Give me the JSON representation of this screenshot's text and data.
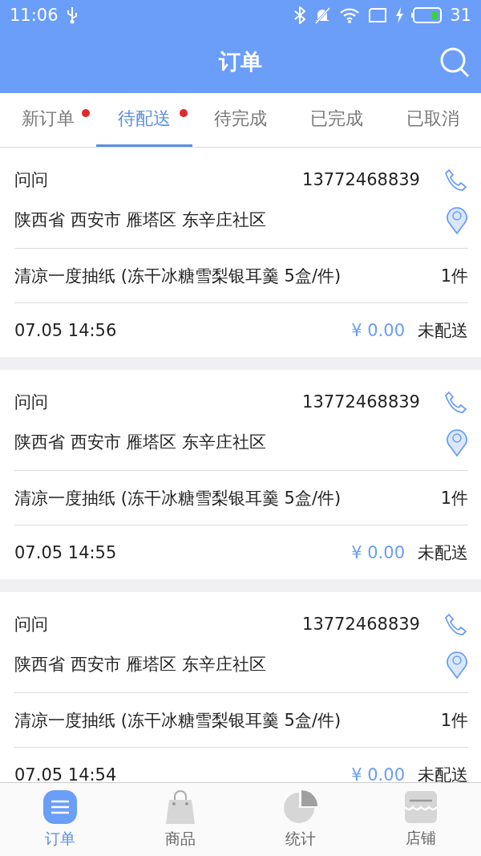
{
  "status_bar": {
    "time": "11:06",
    "battery_text": "31"
  },
  "header": {
    "title": "订单"
  },
  "tabs": [
    {
      "label": "新订单",
      "selected": false,
      "badge": true
    },
    {
      "label": "待配送",
      "selected": true,
      "badge": true
    },
    {
      "label": "待完成",
      "selected": false,
      "badge": false
    },
    {
      "label": "已完成",
      "selected": false,
      "badge": false
    },
    {
      "label": "已取消",
      "selected": false,
      "badge": false
    }
  ],
  "orders": [
    {
      "name": "问问",
      "phone": "13772468839",
      "address": "陕西省 西安市 雁塔区 东辛庄社区",
      "product": "清凉一度抽纸 (冻干冰糖雪梨银耳羹 5盒/件)",
      "quantity": "1件",
      "time": "07.05 14:56",
      "price": "¥ 0.00",
      "status": "未配送"
    },
    {
      "name": "问问",
      "phone": "13772468839",
      "address": "陕西省 西安市 雁塔区 东辛庄社区",
      "product": "清凉一度抽纸 (冻干冰糖雪梨银耳羹 5盒/件)",
      "quantity": "1件",
      "time": "07.05 14:55",
      "price": "¥ 0.00",
      "status": "未配送"
    },
    {
      "name": "问问",
      "phone": "13772468839",
      "address": "陕西省 西安市 雁塔区 东辛庄社区",
      "product": "清凉一度抽纸 (冻干冰糖雪梨银耳羹 5盒/件)",
      "quantity": "1件",
      "time": "07.05 14:54",
      "price": "¥ 0.00",
      "status": "未配送"
    }
  ],
  "bottom_nav": [
    {
      "label": "订单",
      "selected": true,
      "kind": "list"
    },
    {
      "label": "商品",
      "selected": false,
      "kind": "bag"
    },
    {
      "label": "统计",
      "selected": false,
      "kind": "pie"
    },
    {
      "label": "店铺",
      "selected": false,
      "kind": "store"
    }
  ]
}
